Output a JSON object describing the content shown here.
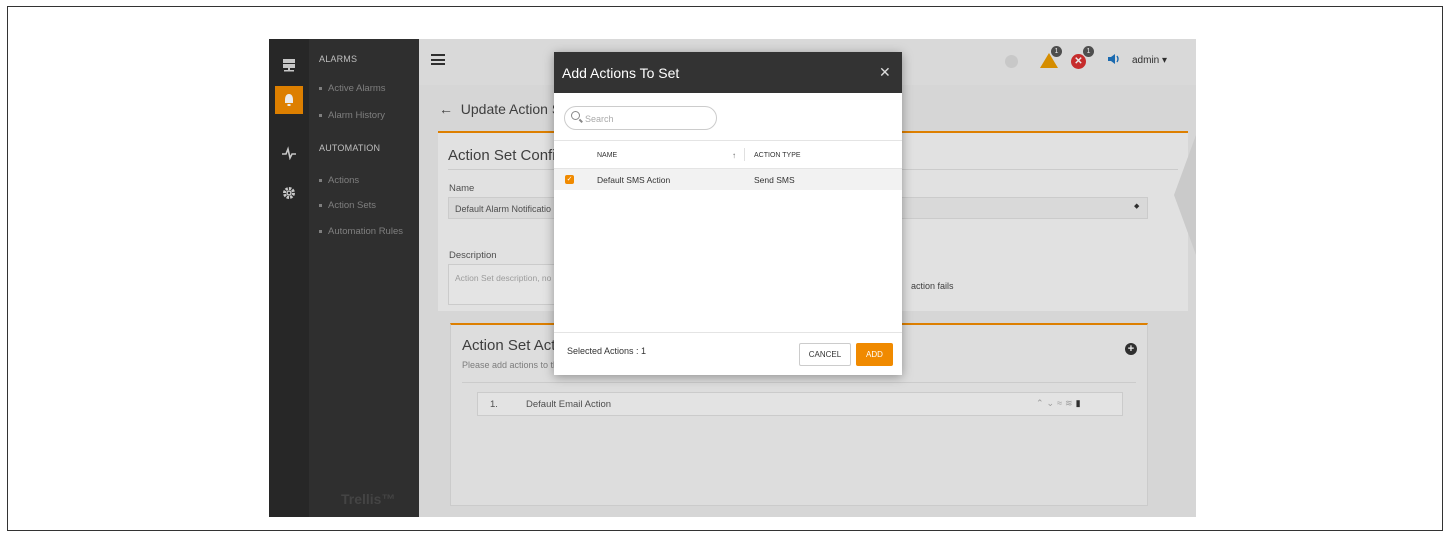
{
  "nav": {
    "sections": [
      {
        "heading": "ALARMS",
        "items": [
          "Active Alarms",
          "Alarm History"
        ]
      },
      {
        "heading": "AUTOMATION",
        "items": [
          "Actions",
          "Action Sets",
          "Automation Rules"
        ]
      }
    ],
    "brand": "Trellis™",
    "rail_icons": [
      "server-icon",
      "alarm-icon",
      "pulse-icon",
      "gear-icon"
    ]
  },
  "header": {
    "warning_count": "1",
    "error_count": "1",
    "user": "admin"
  },
  "page": {
    "back_title": "Update Action S",
    "config": {
      "title": "Action Set Configu",
      "name_label": "Name",
      "name_value": "Default Alarm Notificatio",
      "description_label": "Description",
      "description_placeholder": "Action Set description, no",
      "fail_text": "action fails"
    },
    "actions_card": {
      "title": "Action Set Actio",
      "subtitle": "Please add actions to th",
      "rows": [
        {
          "num": "1.",
          "label": "Default Email Action"
        }
      ]
    }
  },
  "modal": {
    "title": "Add Actions To Set",
    "search_placeholder": "Search",
    "columns": [
      "NAME",
      "ACTION TYPE"
    ],
    "rows": [
      {
        "checked": true,
        "name": "Default SMS Action",
        "type": "Send SMS"
      }
    ],
    "selected_text": "Selected Actions : 1",
    "cancel_label": "CANCEL",
    "add_label": "ADD"
  },
  "colors": {
    "accent": "#f08a00",
    "sidebar": "#333333",
    "rail": "#2b2b2b",
    "modal_header": "#333333",
    "error": "#d73030",
    "warning": "#e89a00",
    "info": "#1e73be"
  }
}
